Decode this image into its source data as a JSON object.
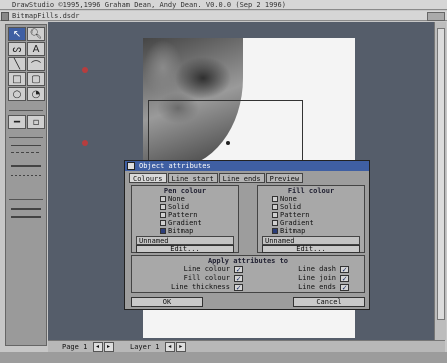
{
  "screen": {
    "title": "DrawStudio ©1995,1996 Graham Dean, Andy Dean. V0.0.0 (Sep  2 1996)",
    "window_title": "BitmapFills.dsdr"
  },
  "toolbox": {
    "tools": [
      {
        "name": "select-arrow-icon",
        "glyph": "↖",
        "active": true
      },
      {
        "name": "zoom-icon",
        "glyph": "🔍︎",
        "active": false
      },
      {
        "name": "freehand-icon",
        "glyph": "ᔕ",
        "active": false
      },
      {
        "name": "text-icon",
        "glyph": "A",
        "active": false
      },
      {
        "name": "line-icon",
        "glyph": "╲",
        "active": false
      },
      {
        "name": "curve-icon",
        "glyph": "⌒",
        "active": false
      },
      {
        "name": "rectangle-icon",
        "glyph": "□",
        "active": false
      },
      {
        "name": "rounded-rect-icon",
        "glyph": "▢",
        "active": false
      },
      {
        "name": "ellipse-icon",
        "glyph": "○",
        "active": false
      },
      {
        "name": "arc-icon",
        "glyph": "◔",
        "active": false
      },
      {
        "name": "polygon-icon",
        "glyph": "━",
        "active": false
      },
      {
        "name": "bitmap-icon",
        "glyph": "▫",
        "active": false
      }
    ]
  },
  "dialog": {
    "title": "Object attributes",
    "tabs": [
      "Colours",
      "Line start",
      "Line ends",
      "Preview"
    ],
    "pen": {
      "heading": "Pen colour",
      "options": [
        "None",
        "Solid",
        "Pattern",
        "Gradient",
        "Bitmap"
      ],
      "selected": "Bitmap",
      "field_value": "Unnamed",
      "edit_label": "Edit..."
    },
    "fill": {
      "heading": "Fill colour",
      "options": [
        "None",
        "Solid",
        "Pattern",
        "Gradient",
        "Bitmap"
      ],
      "selected": "Bitmap",
      "field_value": "Unnamed",
      "edit_label": "Edit..."
    },
    "apply": {
      "heading": "Apply attributes to",
      "left": [
        {
          "label": "Line colour",
          "checked": true
        },
        {
          "label": "Fill colour",
          "checked": true
        },
        {
          "label": "Line thickness",
          "checked": true
        }
      ],
      "right": [
        {
          "label": "Line dash",
          "checked": true
        },
        {
          "label": "Line join",
          "checked": true
        },
        {
          "label": "Line ends",
          "checked": true
        }
      ]
    },
    "ok_label": "OK",
    "cancel_label": "Cancel"
  },
  "statusbar": {
    "page_label": "Page 1",
    "layer_label": "Layer 1"
  },
  "colors": {
    "accent": "#3f5fa3",
    "canvas_bg": "#555d6a",
    "paper": "#f4f4f4"
  }
}
